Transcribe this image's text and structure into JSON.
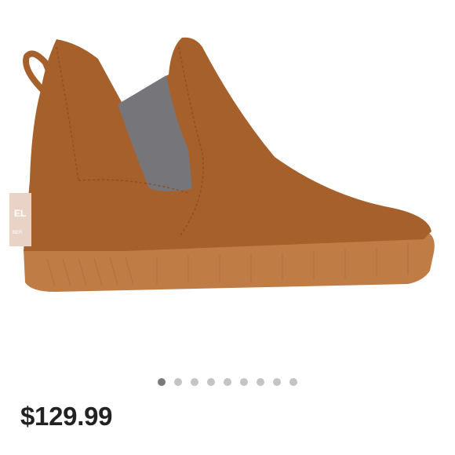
{
  "product": {
    "price": "$129.99",
    "heel_tab_text": [
      "EL",
      "BER"
    ],
    "image_icon": "sorel-ankle-boot-image"
  },
  "carousel": {
    "total_slides": 9,
    "active_index": 0
  },
  "colors": {
    "suede": "#a6602b",
    "sole": "#bf7d45",
    "felt": "#76767a",
    "active_dot": "#7a7a7a",
    "inactive_dot": "#c4c4c4"
  }
}
